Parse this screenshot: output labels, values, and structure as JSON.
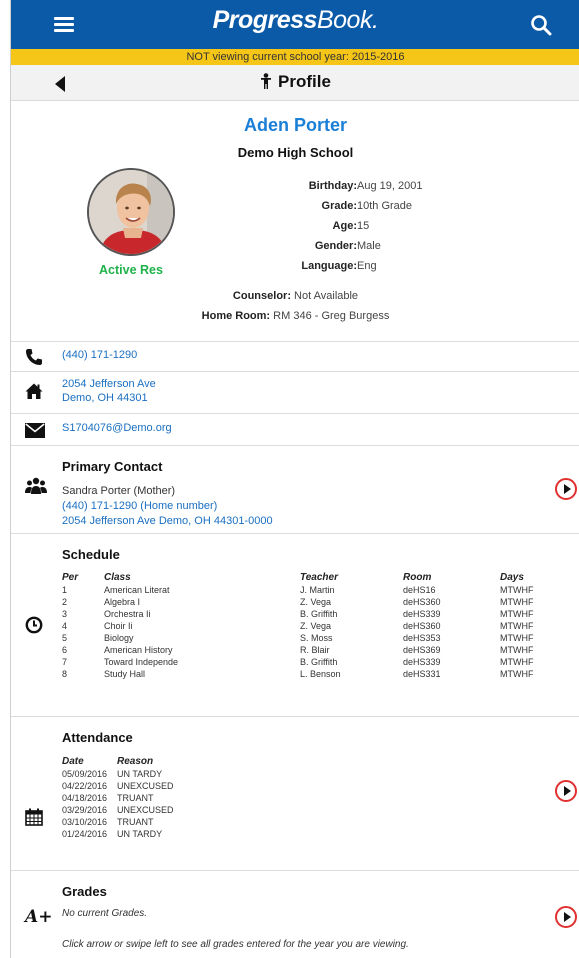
{
  "header": {
    "brand_bold": "Progress",
    "brand_light": "Book",
    "notice": "NOT viewing current school year: 2015-2016",
    "title": "Profile"
  },
  "student": {
    "name": "Aden Porter",
    "school": "Demo High School",
    "status": "Active Res",
    "fields": [
      {
        "label": "Birthday:",
        "value": "Aug 19, 2001"
      },
      {
        "label": "Grade:",
        "value": "10th Grade"
      },
      {
        "label": "Age:",
        "value": "15"
      },
      {
        "label": "Gender:",
        "value": "Male"
      },
      {
        "label": "Language:",
        "value": "Eng"
      }
    ],
    "counselor_label": "Counselor:",
    "counselor": "Not Available",
    "homeroom_label": "Home Room:",
    "homeroom": "RM 346 - Greg Burgess"
  },
  "contact": {
    "phone": "(440) 171-1290",
    "address_line1": "2054 Jefferson Ave",
    "address_line2": "Demo, OH 44301",
    "email": "S1704076@Demo.org"
  },
  "primary_contact": {
    "title": "Primary Contact",
    "name": "Sandra Porter (Mother)",
    "phone": "(440) 171-1290 (Home number)",
    "address": "2054 Jefferson Ave  Demo, OH 44301-0000"
  },
  "schedule": {
    "title": "Schedule",
    "headers": [
      "Per",
      "Class",
      "Teacher",
      "Room",
      "Days"
    ],
    "rows": [
      [
        "1",
        "American Literat",
        "J. Martin",
        "deHS16",
        "MTWHF"
      ],
      [
        "2",
        "Algebra I",
        "Z. Vega",
        "deHS360",
        "MTWHF"
      ],
      [
        "3",
        "Orchestra Ii",
        "B. Griffith",
        "deHS339",
        "MTWHF"
      ],
      [
        "4",
        "Choir Ii",
        "Z. Vega",
        "deHS360",
        "MTWHF"
      ],
      [
        "5",
        "Biology",
        "S. Moss",
        "deHS353",
        "MTWHF"
      ],
      [
        "6",
        "American History",
        "R. Blair",
        "deHS369",
        "MTWHF"
      ],
      [
        "7",
        "Toward Independe",
        "B. Griffith",
        "deHS339",
        "MTWHF"
      ],
      [
        "8",
        "Study Hall",
        "L. Benson",
        "deHS331",
        "MTWHF"
      ]
    ]
  },
  "attendance": {
    "title": "Attendance",
    "headers": [
      "Date",
      "Reason"
    ],
    "rows": [
      [
        "05/09/2016",
        "UN TARDY"
      ],
      [
        "04/22/2016",
        "UNEXCUSED"
      ],
      [
        "04/18/2016",
        "TRUANT"
      ],
      [
        "03/29/2016",
        "UNEXCUSED"
      ],
      [
        "03/10/2016",
        "TRUANT"
      ],
      [
        "01/24/2016",
        "UN TARDY"
      ]
    ]
  },
  "grades": {
    "title": "Grades",
    "icon_text": "A+",
    "empty": "No current Grades.",
    "hint": "Click arrow or swipe left to see all grades entered for the year you are viewing."
  },
  "colors": {
    "topbar": "#0b5aa8",
    "notice": "#f5c518",
    "link": "#1a6fc1",
    "active": "#1fb24a",
    "arrow_ring": "#e13030"
  },
  "icons": {
    "menu": "hamburger-icon",
    "search": "search-icon",
    "back": "back-arrow-icon",
    "phone": "phone-icon",
    "home": "home-icon",
    "email": "envelope-icon",
    "contact": "people-icon",
    "schedule": "clock-icon",
    "attendance": "calendar-icon"
  }
}
